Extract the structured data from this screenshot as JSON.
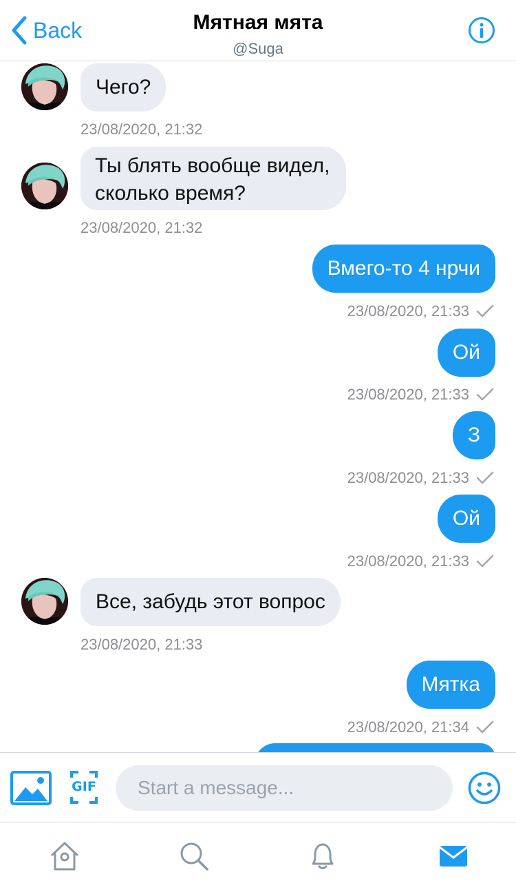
{
  "header": {
    "back_label": "Back",
    "title": "Мятная мята",
    "subtitle": "@Suga"
  },
  "messages": [
    {
      "direction": "in",
      "text": "Чего?",
      "timestamp": "23/08/2020, 21:32"
    },
    {
      "direction": "in",
      "text_lines": [
        "Ты блять вообще видел,",
        "сколько время?"
      ],
      "timestamp": "23/08/2020, 21:32"
    },
    {
      "direction": "out",
      "text": "Вмего-то 4 нрчи",
      "timestamp": "23/08/2020, 21:33",
      "status": "sent"
    },
    {
      "direction": "out",
      "text": "Ой",
      "timestamp": "23/08/2020, 21:33",
      "status": "sent"
    },
    {
      "direction": "out",
      "text": "З",
      "timestamp": "23/08/2020, 21:33",
      "status": "sent"
    },
    {
      "direction": "out",
      "text": "Ой",
      "timestamp": "23/08/2020, 21:33",
      "status": "sent"
    },
    {
      "direction": "in",
      "text": "Все, забудь этот вопрос",
      "timestamp": "23/08/2020, 21:33"
    },
    {
      "direction": "out",
      "text": "Мятка",
      "timestamp": "23/08/2020, 21:34",
      "status": "sent"
    }
  ],
  "composer": {
    "placeholder": "Start a message...",
    "gif_label": "GIF"
  },
  "tabbar": {
    "items": [
      "home-icon",
      "search-icon",
      "notifications-icon",
      "messages-icon"
    ],
    "active": "messages-icon"
  },
  "colors": {
    "accent": "#1d9bf0",
    "incoming_bubble": "#e9ecf2",
    "timestamp": "#8e8e93"
  }
}
